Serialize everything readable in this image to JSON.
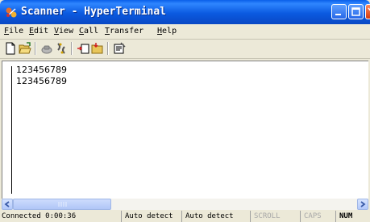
{
  "window": {
    "title": "Scanner - HyperTerminal"
  },
  "icons": {
    "app": "hyperterminal-icon",
    "new": "new-document-icon",
    "open": "open-folder-icon",
    "call": "call-icon",
    "disconnect": "disconnect-icon",
    "send": "send-icon",
    "receive": "receive-icon",
    "properties": "properties-icon"
  },
  "menu": {
    "items": [
      {
        "key": "F",
        "rest": "ile"
      },
      {
        "key": "E",
        "rest": "dit"
      },
      {
        "key": "V",
        "rest": "iew"
      },
      {
        "key": "C",
        "rest": "all"
      },
      {
        "key": "T",
        "rest": "ransfer"
      },
      {
        "key": "H",
        "rest": "elp"
      }
    ]
  },
  "terminal": {
    "lines": [
      "123456789",
      "123456789"
    ]
  },
  "status": {
    "connected": "Connected 0:00:36",
    "detect1": "Auto detect",
    "detect2": "Auto detect",
    "scroll": "SCROLL",
    "caps": "CAPS",
    "num": "NUM"
  },
  "colors": {
    "titlebar": "#0b5ae0",
    "window": "#ece9d8",
    "terminal_bg": "#ffffff"
  }
}
